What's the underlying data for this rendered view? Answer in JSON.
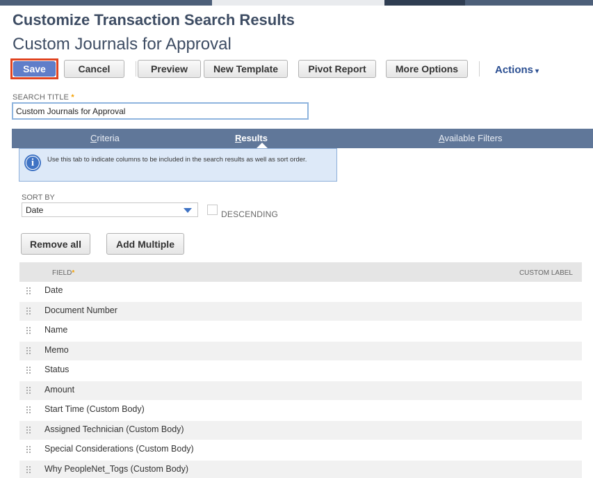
{
  "header": {
    "page_title": "Customize Transaction Search Results",
    "record_title": "Custom Journals for Approval"
  },
  "toolbar": {
    "save": "Save",
    "cancel": "Cancel",
    "preview": "Preview",
    "new_template": "New Template",
    "pivot_report": "Pivot Report",
    "more_options": "More Options",
    "actions": "Actions",
    "actions_caret": "▾"
  },
  "search_title": {
    "label": "SEARCH TITLE",
    "required_mark": "*",
    "value": "Custom Journals for Approval"
  },
  "tabs": {
    "criteria_first": "C",
    "criteria_rest": "riteria",
    "results_first": "R",
    "results_rest": "esults",
    "filters_first": "A",
    "filters_rest": "vailable Filters"
  },
  "info": {
    "icon": "i",
    "text": "Use this tab to indicate columns to be included in the search results as well as sort order."
  },
  "sort": {
    "label": "SORT BY",
    "value": "Date",
    "descending_label": "DESCENDING",
    "descending_checked": false
  },
  "list_buttons": {
    "remove_all": "Remove all",
    "add_multiple": "Add Multiple"
  },
  "grid": {
    "field_header": "FIELD",
    "required_mark": "*",
    "custom_label_header": "CUSTOM LABEL",
    "rows": [
      "Date",
      "Document Number",
      "Name",
      "Memo",
      "Status",
      "Amount",
      "Start Time (Custom Body)",
      "Assigned Technician (Custom Body)",
      "Special Considerations (Custom Body)",
      "Why PeopleNet_Togs (Custom Body)"
    ]
  },
  "colors": {
    "accent_blue": "#607ec9",
    "tab_bar": "#607799",
    "highlight": "#e0431f",
    "title": "#3d4c63",
    "required": "#f4a000"
  }
}
